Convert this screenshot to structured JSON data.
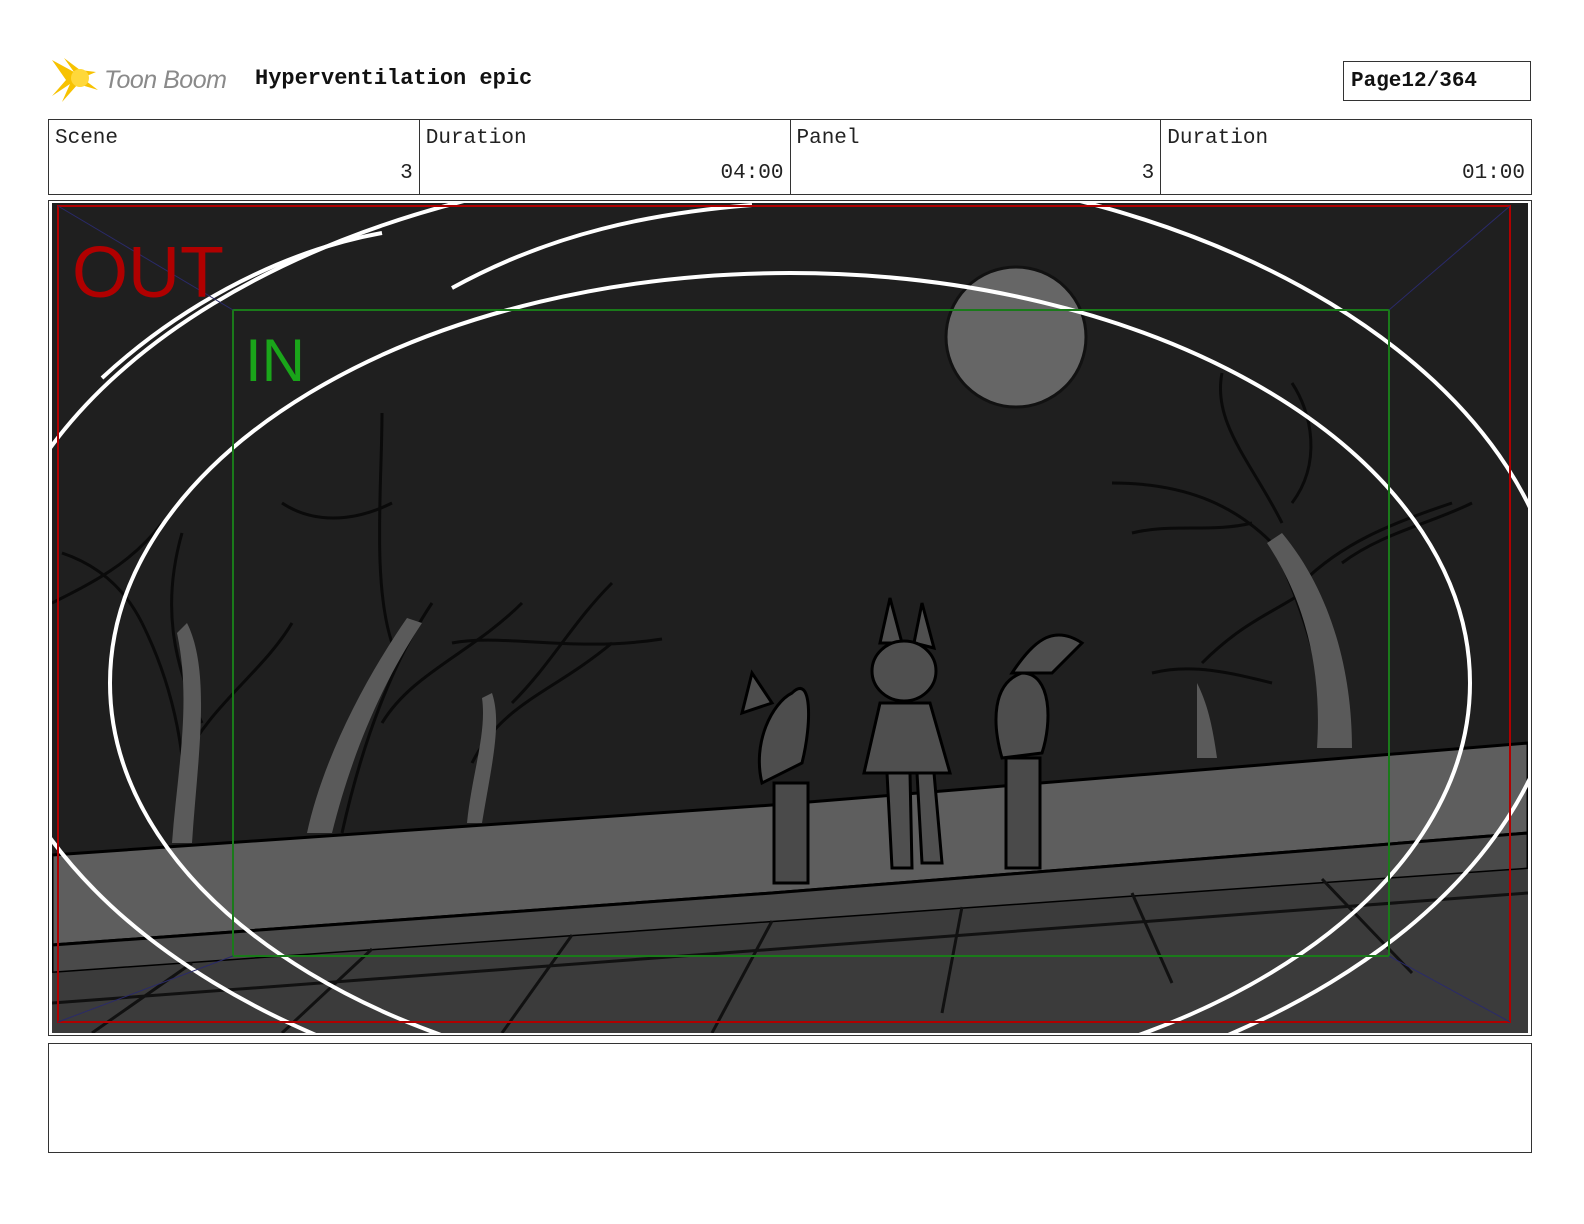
{
  "header": {
    "logo_text": "Toon Boom",
    "project_title": "Hyperventilation epic",
    "page_label": "Page",
    "page_number": "12/364"
  },
  "info": {
    "scene_label": "Scene",
    "scene_value": "3",
    "scene_duration_label": "Duration",
    "scene_duration_value": "04:00",
    "panel_label": "Panel",
    "panel_value": "3",
    "panel_duration_label": "Duration",
    "panel_duration_value": "01:00"
  },
  "panel": {
    "out_label": "OUT",
    "in_label": "IN",
    "out_color": "#b00000",
    "in_color": "#1aa51a",
    "background_color": "#1f1f1f"
  },
  "notes": {
    "text": ""
  }
}
